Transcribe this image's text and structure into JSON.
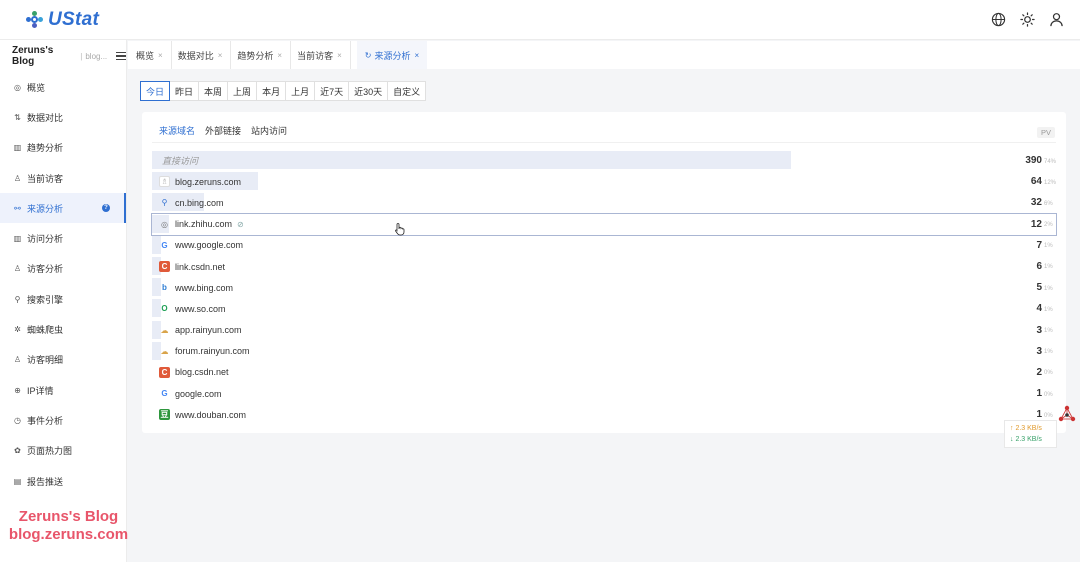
{
  "app": {
    "name": "UStat"
  },
  "site": {
    "name": "Zeruns's Blog",
    "sub": "blog..."
  },
  "nav": [
    {
      "label": "概览",
      "icon": "dashboard-icon",
      "glyph": "◎"
    },
    {
      "label": "数据对比",
      "icon": "compare-icon",
      "glyph": "⇅"
    },
    {
      "label": "趋势分析",
      "icon": "trend-chart-icon",
      "glyph": "▥"
    },
    {
      "label": "当前访客",
      "icon": "user-icon",
      "glyph": "♙"
    },
    {
      "label": "来源分析",
      "icon": "share-icon",
      "glyph": "⚯",
      "active": true
    },
    {
      "label": "访问分析",
      "icon": "bar-chart-icon",
      "glyph": "▥"
    },
    {
      "label": "访客分析",
      "icon": "users-icon",
      "glyph": "♙"
    },
    {
      "label": "搜索引擎",
      "icon": "search-icon",
      "glyph": "⚲"
    },
    {
      "label": "蜘蛛爬虫",
      "icon": "bug-icon",
      "glyph": "✲"
    },
    {
      "label": "访客明细",
      "icon": "user-detail-icon",
      "glyph": "♙"
    },
    {
      "label": "IP详情",
      "icon": "ip-icon",
      "glyph": "⊕"
    },
    {
      "label": "事件分析",
      "icon": "clock-icon",
      "glyph": "◷"
    },
    {
      "label": "页面热力图",
      "icon": "heatmap-icon",
      "glyph": "✿"
    },
    {
      "label": "报告推送",
      "icon": "report-icon",
      "glyph": "▤"
    }
  ],
  "tabs": [
    {
      "label": "概览"
    },
    {
      "label": "数据对比"
    },
    {
      "label": "趋势分析"
    },
    {
      "label": "当前访客"
    },
    {
      "label": "来源分析",
      "active": true
    }
  ],
  "ranges": [
    "今日",
    "昨日",
    "本周",
    "上周",
    "本月",
    "上月",
    "近7天",
    "近30天",
    "自定义"
  ],
  "subtabs": [
    "来源域名",
    "外部链接",
    "站内访问"
  ],
  "pv_label": "PV",
  "rows": [
    {
      "name": "直接访问",
      "value": "390",
      "pct": "74%",
      "share": 0.74,
      "icon": "none",
      "muted": true
    },
    {
      "name": "blog.zeruns.com",
      "value": "64",
      "pct": "12%",
      "share": 0.12,
      "icon": "blog-favicon-icon"
    },
    {
      "name": "cn.bing.com",
      "value": "32",
      "pct": "6%",
      "share": 0.06,
      "icon": "bing-search-icon"
    },
    {
      "name": "link.zhihu.com",
      "value": "12",
      "pct": "2%",
      "share": 0.02,
      "icon": "zhihu-icon",
      "hover": true,
      "link": true
    },
    {
      "name": "www.google.com",
      "value": "7",
      "pct": "1%",
      "share": 0.01,
      "icon": "google-icon"
    },
    {
      "name": "link.csdn.net",
      "value": "6",
      "pct": "1%",
      "share": 0.01,
      "icon": "csdn-icon"
    },
    {
      "name": "www.bing.com",
      "value": "5",
      "pct": "1%",
      "share": 0.01,
      "icon": "bing-icon"
    },
    {
      "name": "www.so.com",
      "value": "4",
      "pct": "1%",
      "share": 0.01,
      "icon": "so-icon"
    },
    {
      "name": "app.rainyun.com",
      "value": "3",
      "pct": "1%",
      "share": 0.01,
      "icon": "rainyun-icon"
    },
    {
      "name": "forum.rainyun.com",
      "value": "3",
      "pct": "1%",
      "share": 0.01,
      "icon": "rainyun-icon"
    },
    {
      "name": "blog.csdn.net",
      "value": "2",
      "pct": "0%",
      "share": 0.0,
      "icon": "csdn-icon"
    },
    {
      "name": "google.com",
      "value": "1",
      "pct": "0%",
      "share": 0.0,
      "icon": "google-icon"
    },
    {
      "name": "www.douban.com",
      "value": "1",
      "pct": "0%",
      "share": 0.0,
      "icon": "douban-icon"
    }
  ],
  "speed": {
    "up": "↑ 2.3 KB/s",
    "down": "↓ 2.3 KB/s"
  },
  "watermark": {
    "line1": "Zeruns's Blog",
    "line2": "blog.zeruns.com"
  },
  "colors": {
    "accent": "#2f6fd1",
    "bar": "#e8ecf6"
  }
}
